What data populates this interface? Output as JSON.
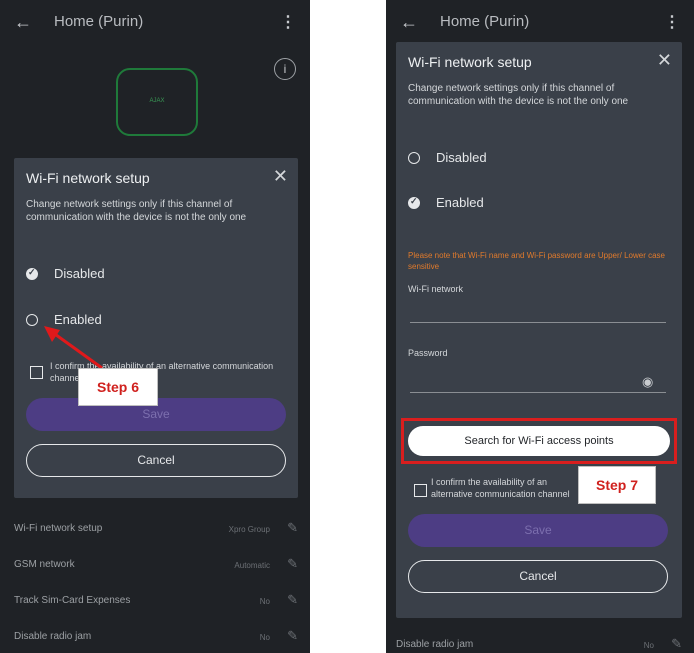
{
  "left": {
    "header": {
      "back": "←",
      "title": "Home (Purin)",
      "menu": "⋮"
    },
    "device_logo": "AJAX",
    "info": "i",
    "modal": {
      "title": "Wi-Fi network setup",
      "close": "✕",
      "description": "Change network settings only if this channel of communication with the device is not the only one",
      "radios": [
        {
          "label": "Disabled",
          "selected": true
        },
        {
          "label": "Enabled",
          "selected": false
        }
      ],
      "confirm_text": "I confirm the availability of an alternative communication channel",
      "save": "Save",
      "cancel": "Cancel"
    },
    "settings": [
      {
        "label": "Wi-Fi network setup",
        "value": "Xpro Group"
      },
      {
        "label": "GSM network",
        "value": "Automatic"
      },
      {
        "label": "Track Sim-Card Expenses",
        "value": "No"
      },
      {
        "label": "Disable radio jam",
        "value": "No"
      }
    ],
    "step_label": "Step 6"
  },
  "right": {
    "header": {
      "back": "←",
      "title": "Home (Purin)",
      "menu": "⋮"
    },
    "modal": {
      "title": "Wi-Fi network setup",
      "close": "✕",
      "description": "Change network settings only if this channel of communication with the device is not the only one",
      "radios": [
        {
          "label": "Disabled",
          "selected": false
        },
        {
          "label": "Enabled",
          "selected": true
        }
      ],
      "note": "Please note that Wi-Fi name and Wi-Fi password are Upper/ Lower case sensitive",
      "wifi_network_label": "Wi-Fi network",
      "password_label": "Password",
      "search_button": "Search for Wi-Fi access points",
      "confirm_text": "I confirm the availability of an alternative communication channel",
      "save": "Save",
      "cancel": "Cancel"
    },
    "settings": [
      {
        "label": "Disable radio jam",
        "value": "No"
      }
    ],
    "step_label": "Step 7"
  },
  "colors": {
    "accent": "#4d3d84",
    "highlight": "#d91e1e",
    "note": "#e07a2c"
  }
}
